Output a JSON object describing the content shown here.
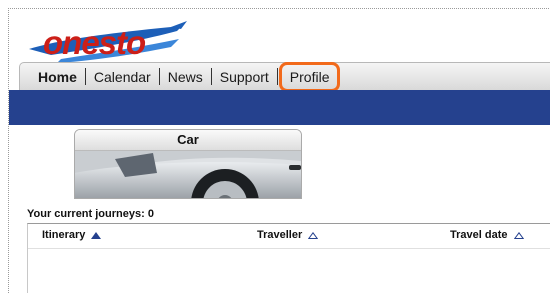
{
  "app": {
    "logo_text": "onesto"
  },
  "nav": {
    "items": [
      {
        "label": "Home",
        "active": true
      },
      {
        "label": "Calendar"
      },
      {
        "label": "News"
      },
      {
        "label": "Support"
      },
      {
        "label": "Profile",
        "highlighted": true
      }
    ]
  },
  "car_panel": {
    "title": "Car"
  },
  "journeys": {
    "label": "Your current journeys: 0",
    "columns": [
      {
        "label": "Itinerary",
        "sort_icon": "triangle-up-filled"
      },
      {
        "label": "Traveller",
        "sort_icon": "triangle-up-outline"
      },
      {
        "label": "Travel date",
        "sort_icon": "triangle-up-outline"
      }
    ],
    "rows": []
  },
  "colors": {
    "brand_red": "#cc1f18",
    "nav_band": "#25418e",
    "highlight": "#f26a1b"
  }
}
